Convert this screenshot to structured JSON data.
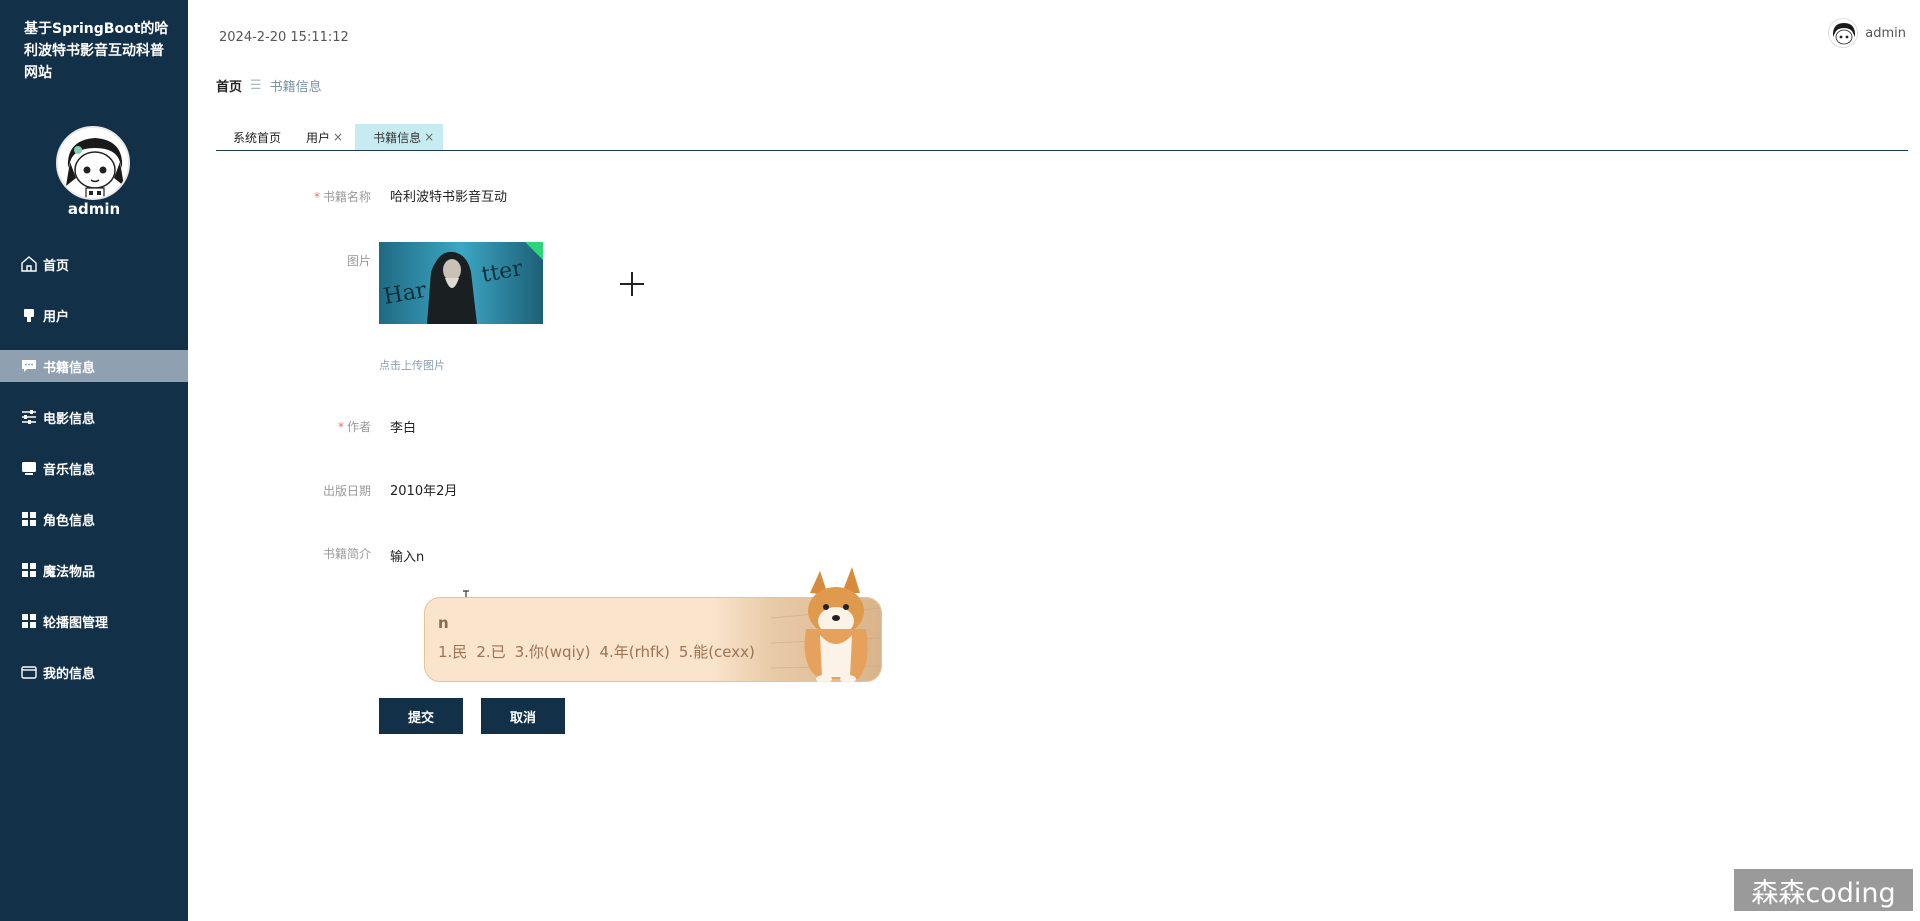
{
  "site_title": "基于SpringBoot的哈利波特书影音互动科普网站",
  "sidebar": {
    "username": "admin",
    "items": [
      {
        "label": "首页",
        "icon": "home-icon"
      },
      {
        "label": "用户",
        "icon": "user-icon"
      },
      {
        "label": "书籍信息",
        "icon": "chat-icon"
      },
      {
        "label": "电影信息",
        "icon": "sliders-icon"
      },
      {
        "label": "音乐信息",
        "icon": "monitor-icon"
      },
      {
        "label": "角色信息",
        "icon": "grid-icon"
      },
      {
        "label": "魔法物品",
        "icon": "grid-icon"
      },
      {
        "label": "轮播图管理",
        "icon": "grid-icon"
      },
      {
        "label": "我的信息",
        "icon": "wallet-icon"
      }
    ],
    "active_index": 2
  },
  "header": {
    "datetime": "2024-2-20 15:11:12",
    "username": "admin"
  },
  "breadcrumb": {
    "home": "首页",
    "separator": "☰",
    "current": "书籍信息"
  },
  "tabs": [
    {
      "label": "系统首页",
      "closable": false
    },
    {
      "label": "用户",
      "closable": true,
      "close": "×"
    },
    {
      "label": "书籍信息",
      "closable": true,
      "close": "×",
      "active": true
    }
  ],
  "form": {
    "book_name": {
      "label": "书籍名称",
      "required_mark": "*",
      "value": "哈利波特书影音互动"
    },
    "image": {
      "label": "图片",
      "upload_hint": "点击上传图片"
    },
    "author": {
      "label": "作者",
      "required_mark": "*",
      "value": "李白"
    },
    "publish_date": {
      "label": "出版日期",
      "value": "2010年2月"
    },
    "intro": {
      "label": "书籍简介",
      "value": "输入n"
    }
  },
  "ime": {
    "input": "n",
    "candidates": [
      "1.民",
      "2.已",
      "3.你(wqiy)",
      "4.年(rhfk)",
      "5.能(cexx)"
    ]
  },
  "buttons": {
    "submit": "提交",
    "cancel": "取消"
  },
  "watermark": "森森coding",
  "colors": {
    "sidebar_bg": "#133049",
    "active_menu_bg": "#8fa1b0",
    "active_tab_bg": "#c6ecf2",
    "required": "#f56c6c",
    "button_bg": "#133049",
    "ime_bg": "#fae4cc"
  }
}
